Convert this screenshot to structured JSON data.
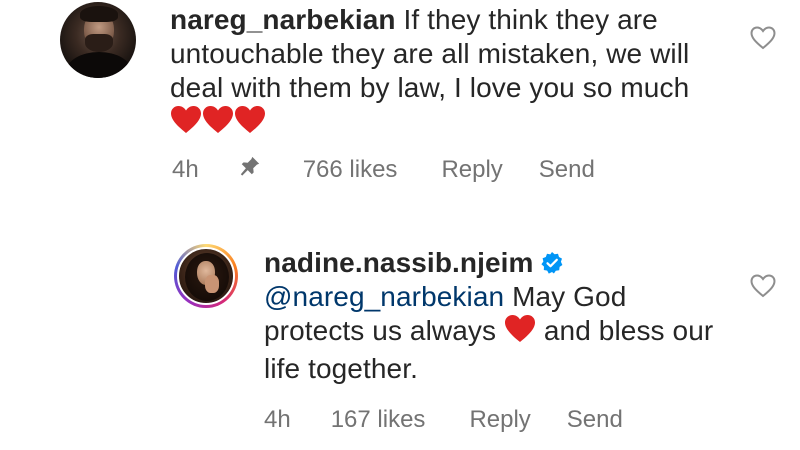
{
  "comments": [
    {
      "username": "nareg_narbekian",
      "text_parts": [
        "If they think they are untouchable they are all mistaken, we will deal with them by law, I love you so much "
      ],
      "emoji": "red-heart-emoji x3",
      "meta": {
        "time": "4h",
        "pinned": true,
        "likes": "766 likes",
        "reply": "Reply",
        "send": "Send"
      }
    },
    {
      "username": "nadine.nassib.njeim",
      "verified": true,
      "mention": "@nareg_narbekian",
      "text_before_heart": " May God protects us  always ",
      "text_after_heart": " and bless our life together.",
      "emoji": "red-heart-emoji",
      "meta": {
        "time": "4h",
        "likes": "167 likes",
        "reply": "Reply",
        "send": "Send"
      }
    }
  ],
  "colors": {
    "text": "#262626",
    "secondary": "#737373",
    "mention": "#00376b",
    "heart_emoji": "#e02424",
    "verified": "#0095f6"
  }
}
